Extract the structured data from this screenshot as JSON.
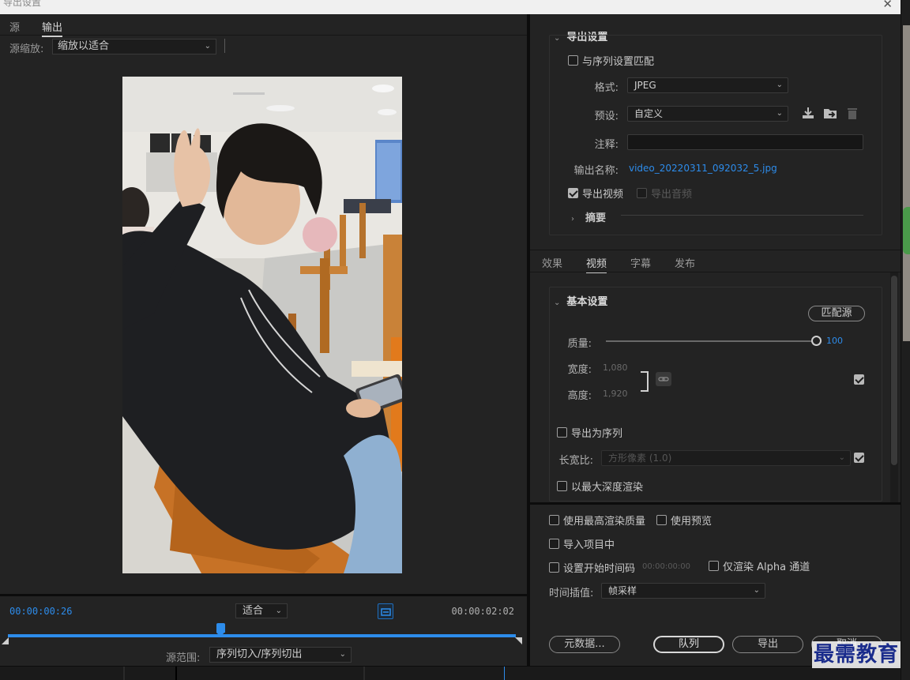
{
  "window": {
    "title": "导出设置"
  },
  "left": {
    "tabs": [
      {
        "label": "源"
      },
      {
        "label": "输出"
      }
    ],
    "source_zoom": {
      "label": "源缩放:",
      "value": "缩放以适合"
    },
    "timeline": {
      "current_tc": "00:00:00:26",
      "end_tc": "00:00:02:02",
      "fit_value": "适合",
      "range_label": "源范围:",
      "range_value": "序列切入/序列切出"
    }
  },
  "export_settings": {
    "title": "导出设置",
    "match_sequence": "与序列设置匹配",
    "format_label": "格式:",
    "format_value": "JPEG",
    "preset_label": "预设:",
    "preset_value": "自定义",
    "comment_label": "注释:",
    "output_name_label": "输出名称:",
    "output_name_value": "video_20220311_092032_5.jpg",
    "export_video": "导出视频",
    "export_audio": "导出音频",
    "summary": "摘要"
  },
  "mid_tabs": [
    {
      "label": "效果"
    },
    {
      "label": "视频"
    },
    {
      "label": "字幕"
    },
    {
      "label": "发布"
    }
  ],
  "basic": {
    "title": "基本设置",
    "match_source": "匹配源",
    "quality_label": "质量:",
    "quality_value": "100",
    "width_label": "宽度:",
    "width_value": "1,080",
    "height_label": "高度:",
    "height_value": "1,920",
    "export_sequence": "导出为序列",
    "aspect_label": "长宽比:",
    "aspect_value": "方形像素 (1.0)",
    "max_depth": "以最大深度渲染"
  },
  "bottom": {
    "max_render": "使用最高渲染质量",
    "use_preview": "使用预览",
    "import_project": "导入项目中",
    "set_start_tc": "设置开始时间码",
    "start_tc_value": "00:00:00:00",
    "alpha_only": "仅渲染 Alpha 通道",
    "interp_label": "时间插值:",
    "interp_value": "帧采样",
    "metadata_btn": "元数据...",
    "queue_btn": "队列",
    "export_btn": "导出",
    "cancel_btn": "取消"
  },
  "watermark": {
    "text": "最需教育"
  },
  "colors": {
    "accent": "#2d8ceb",
    "panel": "#232323",
    "divider": "#0c0c0c"
  }
}
